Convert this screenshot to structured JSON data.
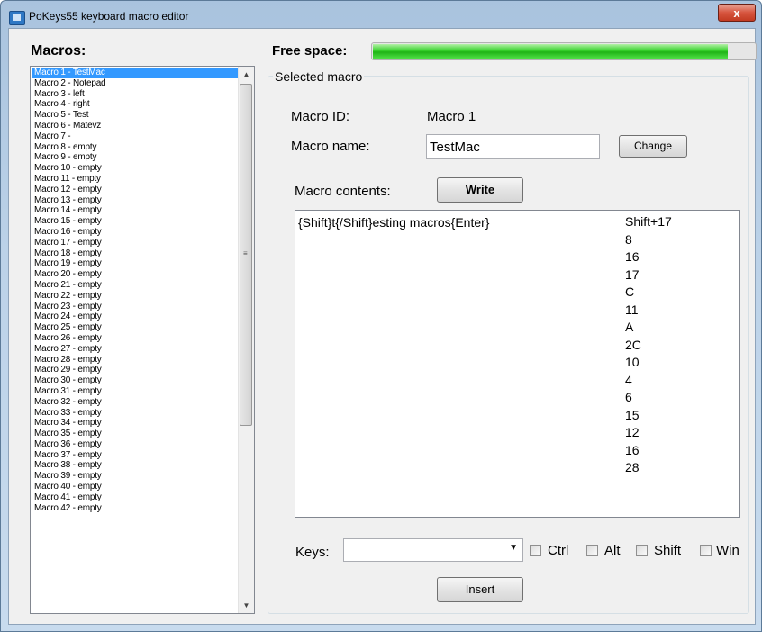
{
  "window": {
    "title": "PoKeys55 keyboard macro editor",
    "close_glyph": "x",
    "icon": "app-icon"
  },
  "macros": {
    "label": "Macros:",
    "items": [
      "Macro 1 - TestMac",
      "Macro 2 - Notepad",
      "Macro 3 - left",
      "Macro 4 - right",
      "Macro 5 - Test",
      "Macro 6 - Matevz",
      "Macro 7 -",
      "Macro 8 - empty",
      "Macro 9 - empty",
      "Macro 10 - empty",
      "Macro 11 - empty",
      "Macro 12 - empty",
      "Macro 13 - empty",
      "Macro 14 - empty",
      "Macro 15 - empty",
      "Macro 16 - empty",
      "Macro 17 - empty",
      "Macro 18 - empty",
      "Macro 19 - empty",
      "Macro 20 - empty",
      "Macro 21 - empty",
      "Macro 22 - empty",
      "Macro 23 - empty",
      "Macro 24 - empty",
      "Macro 25 - empty",
      "Macro 26 - empty",
      "Macro 27 - empty",
      "Macro 28 - empty",
      "Macro 29 - empty",
      "Macro 30 - empty",
      "Macro 31 - empty",
      "Macro 32 - empty",
      "Macro 33 - empty",
      "Macro 34 - empty",
      "Macro 35 - empty",
      "Macro 36 - empty",
      "Macro 37 - empty",
      "Macro 38 - empty",
      "Macro 39 - empty",
      "Macro 40 - empty",
      "Macro 41 - empty",
      "Macro 42 - empty"
    ],
    "selected_index": 0,
    "scroll_up_glyph": "▲",
    "scroll_down_glyph": "▼"
  },
  "free_space": {
    "label": "Free space:",
    "used_fraction": 0.93,
    "color": "#22c21a"
  },
  "selected_macro": {
    "group_title": "Selected macro",
    "id_label": "Macro ID:",
    "id_value": "Macro 1",
    "name_label": "Macro name:",
    "name_value": "TestMac",
    "change_button": "Change",
    "contents_label": "Macro contents:",
    "write_button": "Write",
    "contents_text": "{Shift}t{/Shift}esting macros{Enter}",
    "key_codes": [
      "Shift+17",
      "8",
      "16",
      "17",
      "C",
      "11",
      "A",
      "2C",
      "10",
      "4",
      "6",
      "15",
      "12",
      "16",
      "28"
    ]
  },
  "keys": {
    "label": "Keys:",
    "selected_value": "",
    "dropdown_glyph": "▼",
    "modifiers": [
      {
        "label": "Ctrl",
        "checked": false
      },
      {
        "label": "Alt",
        "checked": false
      },
      {
        "label": "Shift",
        "checked": false
      },
      {
        "label": "Win",
        "checked": false
      }
    ],
    "insert_button": "Insert"
  }
}
